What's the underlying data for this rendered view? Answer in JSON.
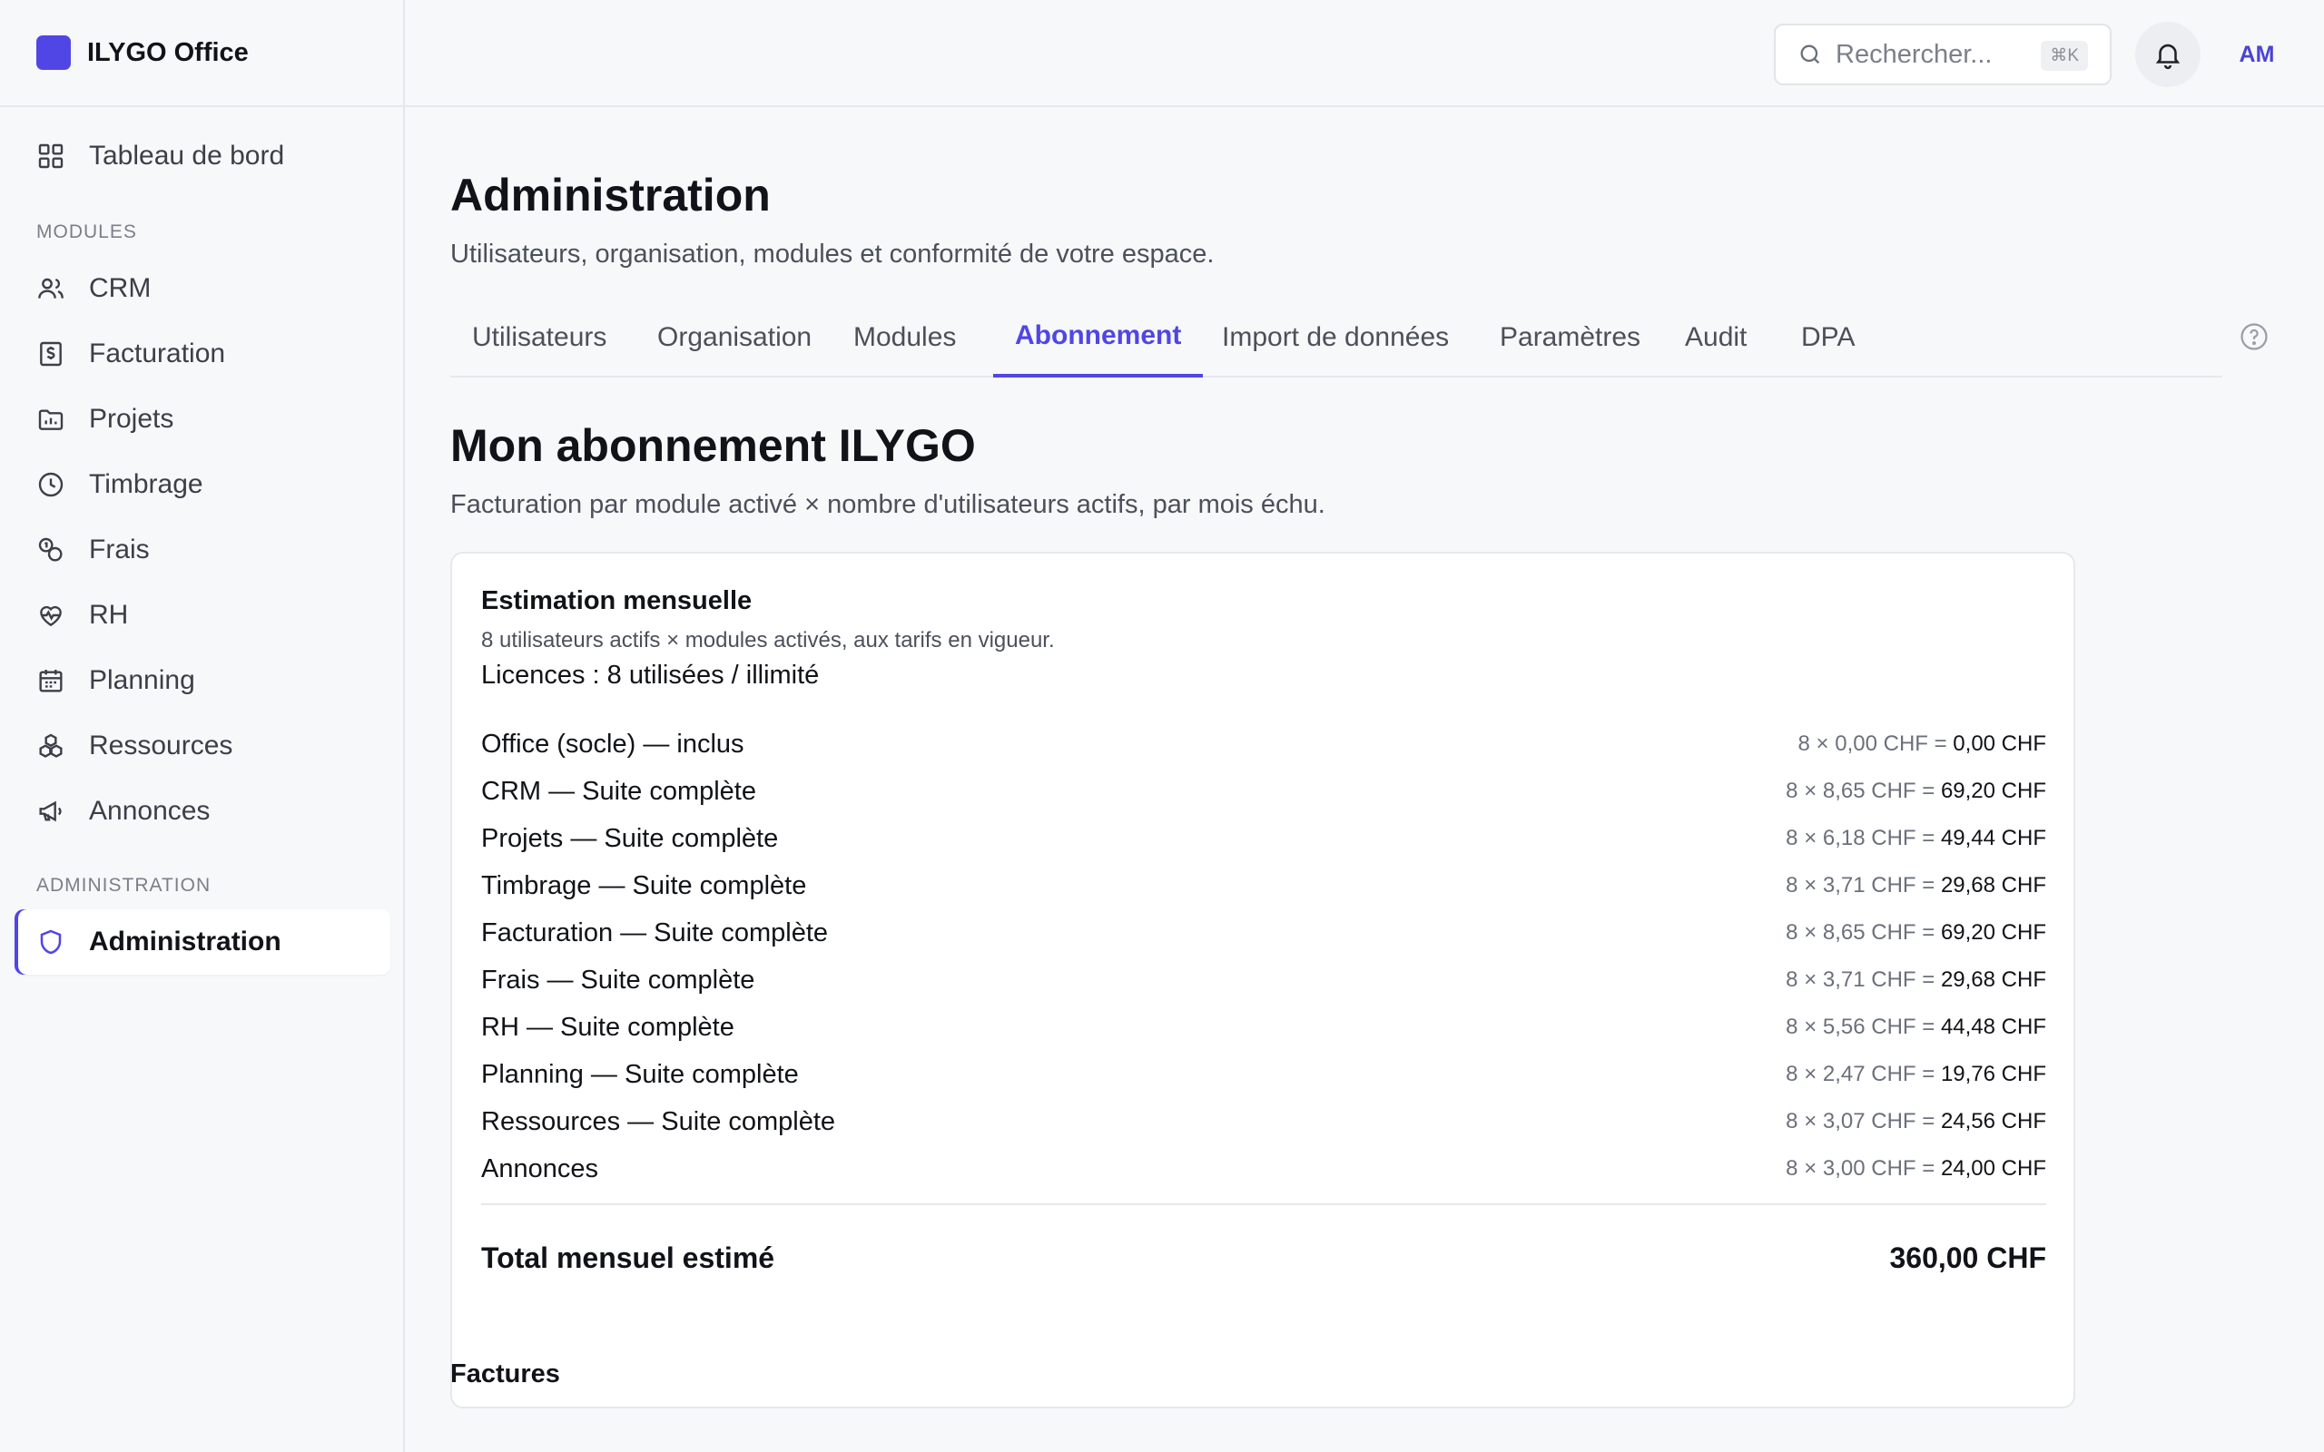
{
  "app": {
    "name": "ILYGO Office"
  },
  "sidebar": {
    "dashboard": "Tableau de bord",
    "modules_heading": "MODULES",
    "modules": [
      "CRM",
      "Facturation",
      "Projets",
      "Timbrage",
      "Frais",
      "RH",
      "Planning",
      "Ressources",
      "Annonces"
    ],
    "admin_heading": "ADMINISTRATION",
    "admin_item": "Administration"
  },
  "topbar": {
    "search_placeholder": "Rechercher...",
    "search_shortcut": "⌘K",
    "avatar_initials": "AM"
  },
  "page": {
    "title": "Administration",
    "subtitle": "Utilisateurs, organisation, modules et conformité de votre espace."
  },
  "tabs": [
    "Utilisateurs",
    "Organisation",
    "Modules",
    "Abonnement",
    "Import de données",
    "Paramètres",
    "Audit",
    "DPA"
  ],
  "active_tab": "Abonnement",
  "subscription": {
    "title": "Mon abonnement ILYGO",
    "subtitle": "Facturation par module activé × nombre d'utilisateurs actifs, par mois échu.",
    "card_title": "Estimation mensuelle",
    "card_subtitle": "8 utilisateurs actifs × modules activés, aux tarifs en vigueur.",
    "licenses": "Licences : 8 utilisées / illimité",
    "lines": [
      {
        "label": "Office (socle) — inclus",
        "calc": "8 × 0,00 CHF =",
        "total": "0,00 CHF"
      },
      {
        "label": "CRM — Suite complète",
        "calc": "8 × 8,65 CHF =",
        "total": "69,20 CHF"
      },
      {
        "label": "Projets — Suite complète",
        "calc": "8 × 6,18 CHF =",
        "total": "49,44 CHF"
      },
      {
        "label": "Timbrage — Suite complète",
        "calc": "8 × 3,71 CHF =",
        "total": "29,68 CHF"
      },
      {
        "label": "Facturation — Suite complète",
        "calc": "8 × 8,65 CHF =",
        "total": "69,20 CHF"
      },
      {
        "label": "Frais — Suite complète",
        "calc": "8 × 3,71 CHF =",
        "total": "29,68 CHF"
      },
      {
        "label": "RH — Suite complète",
        "calc": "8 × 5,56 CHF =",
        "total": "44,48 CHF"
      },
      {
        "label": "Planning — Suite complète",
        "calc": "8 × 2,47 CHF =",
        "total": "19,76 CHF"
      },
      {
        "label": "Ressources — Suite complète",
        "calc": "8 × 3,07 CHF =",
        "total": "24,56 CHF"
      },
      {
        "label": "Annonces",
        "calc": "8 × 3,00 CHF =",
        "total": "24,00 CHF"
      }
    ],
    "total_label": "Total mensuel estimé",
    "total_value": "360,00 CHF"
  },
  "invoices": {
    "title": "Factures"
  },
  "colors": {
    "accent": "#5046e5",
    "border": "#e6e8ec",
    "muted": "#6b707b"
  }
}
